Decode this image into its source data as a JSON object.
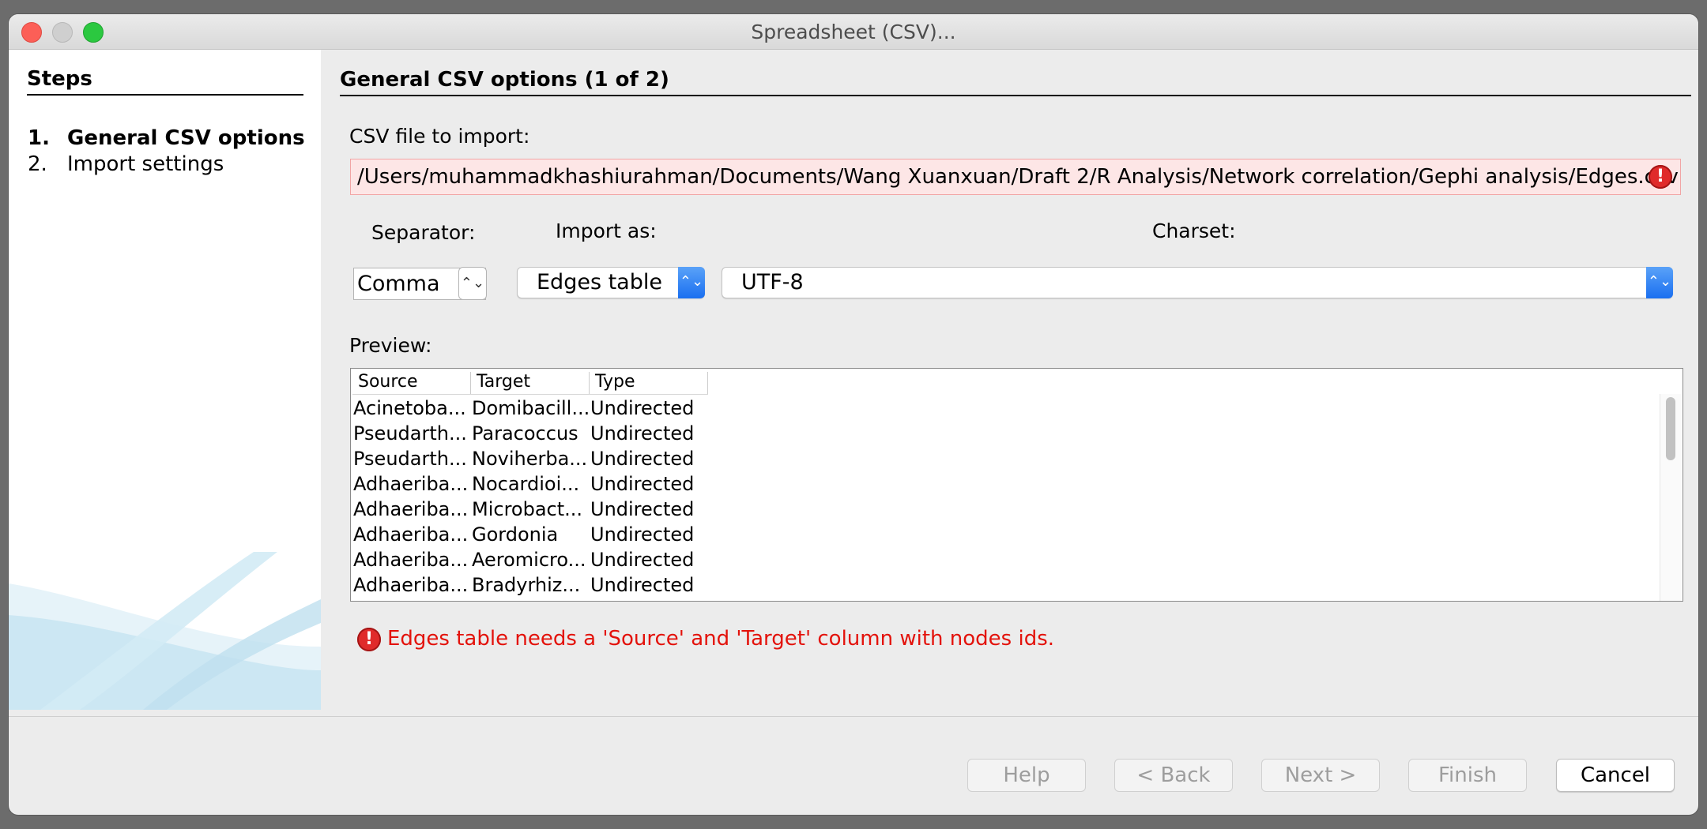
{
  "window": {
    "title": "Spreadsheet (CSV)..."
  },
  "steps": {
    "title": "Steps",
    "items": [
      {
        "num": "1.",
        "label": "General CSV options"
      },
      {
        "num": "2.",
        "label": "Import settings"
      }
    ]
  },
  "main": {
    "title": "General CSV options (1 of 2)",
    "file_label": "CSV file to import:",
    "file_path": "/Users/muhammadkhashiurahman/Documents/Wang Xuanxuan/Draft 2/R Analysis/Network correlation/Gephi analysis/Edges.csv",
    "separator_label": "Separator:",
    "separator_value": "Comma",
    "import_as_label": "Import as:",
    "import_as_value": "Edges table",
    "charset_label": "Charset:",
    "charset_value": "UTF-8",
    "preview_label": "Preview:",
    "preview": {
      "columns": [
        "Source",
        "Target",
        "Type"
      ],
      "rows": [
        [
          "Acinetoba...",
          "Domibacill...",
          "Undirected"
        ],
        [
          "Pseudarth...",
          "Paracoccus",
          "Undirected"
        ],
        [
          "Pseudarth...",
          "Noviherba...",
          "Undirected"
        ],
        [
          "Adhaeriba...",
          "Nocardioi...",
          "Undirected"
        ],
        [
          "Adhaeriba...",
          "Microbact...",
          "Undirected"
        ],
        [
          "Adhaeriba...",
          "Gordonia",
          "Undirected"
        ],
        [
          "Adhaeriba...",
          "Aeromicro...",
          "Undirected"
        ],
        [
          "Adhaeriba...",
          "Bradyrhiz...",
          "Undirected"
        ]
      ]
    },
    "error_message": "Edges table needs a 'Source' and 'Target' column with nodes ids.",
    "error_icon_glyph": "!"
  },
  "buttons": {
    "help": "Help",
    "back": "< Back",
    "next": "Next >",
    "finish": "Finish",
    "cancel": "Cancel"
  },
  "icons": {
    "stepper": "⌃⌄",
    "chevron": "⌃⌄"
  }
}
